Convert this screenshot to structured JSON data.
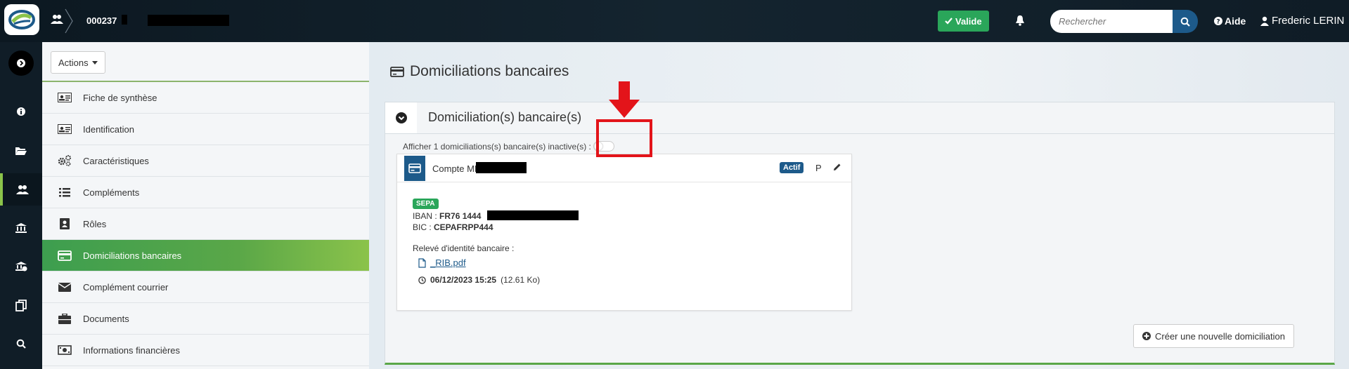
{
  "header": {
    "entity_id": "000237",
    "valide_label": "Valide",
    "search_placeholder": "Rechercher",
    "help_label": "Aide",
    "user_name": "Frederic LERIN"
  },
  "subnav": {
    "actions_label": "Actions",
    "items": [
      {
        "label": "Fiche de synthèse",
        "icon": "id-card-icon"
      },
      {
        "label": "Identification",
        "icon": "id-card-icon"
      },
      {
        "label": "Caractéristiques",
        "icon": "cogs-icon"
      },
      {
        "label": "Compléments",
        "icon": "list-icon"
      },
      {
        "label": "Rôles",
        "icon": "role-icon"
      },
      {
        "label": "Domiciliations bancaires",
        "icon": "credit-card-icon",
        "active": true
      },
      {
        "label": "Complément courrier",
        "icon": "envelope-icon"
      },
      {
        "label": "Documents",
        "icon": "briefcase-icon"
      },
      {
        "label": "Informations financières",
        "icon": "money-icon"
      }
    ]
  },
  "main": {
    "page_title": "Domiciliations bancaires",
    "panel_title": "Domiciliation(s) bancaire(s)",
    "inactive_label": "Afficher 1 domiciliations(s) bancaire(s) inactive(s) :",
    "card": {
      "title": "Compte MME",
      "status_badge": "Actif",
      "p_label": "P",
      "sepa_badge": "SEPA",
      "iban_label": "IBAN :",
      "iban_value": "FR76 1444",
      "bic_label": "BIC :",
      "bic_value": "CEPAFRPP444",
      "rib_label": "Relevé d'identité bancaire :",
      "file_name": "_RIB.pdf",
      "file_date": "06/12/2023 15:25",
      "file_size": "(12.61 Ko)"
    },
    "create_label": "Créer une nouvelle domiciliation"
  },
  "colors": {
    "accent_green": "#5aa748",
    "primary_blue": "#1d5a8a",
    "highlight_red": "#e3141a"
  }
}
